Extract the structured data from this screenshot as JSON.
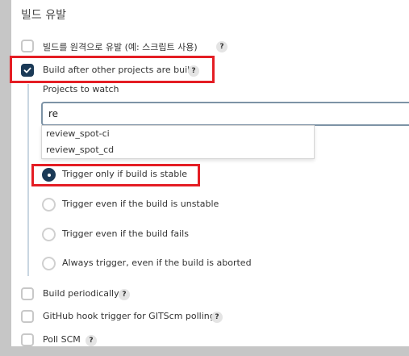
{
  "section": {
    "title": "빌드 유발"
  },
  "triggers": {
    "remote": {
      "label": "빌드를 원격으로 유발 (예: 스크립트 사용)",
      "help": "?",
      "checked": false
    },
    "after_other": {
      "label": "Build after other projects are built",
      "help": "?",
      "checked": true
    },
    "periodically": {
      "label": "Build periodically",
      "help": "?",
      "checked": false
    },
    "github_hook": {
      "label": "GitHub hook trigger for GITScm polling",
      "help": "?",
      "checked": false
    },
    "poll_scm": {
      "label": "Poll SCM",
      "help": "?",
      "checked": false
    }
  },
  "projects_to_watch": {
    "label": "Projects to watch",
    "value": "re",
    "suggestions": [
      "review_spot-ci",
      "review_spot_cd"
    ]
  },
  "trigger_options": [
    {
      "label": "Trigger only if build is stable",
      "selected": true
    },
    {
      "label": "Trigger even if the build is unstable",
      "selected": false
    },
    {
      "label": "Trigger even if the build fails",
      "selected": false
    },
    {
      "label": "Always trigger, even if the build is aborted",
      "selected": false
    }
  ],
  "colors": {
    "accent": "#1b3a57",
    "highlight": "#e41d24"
  }
}
